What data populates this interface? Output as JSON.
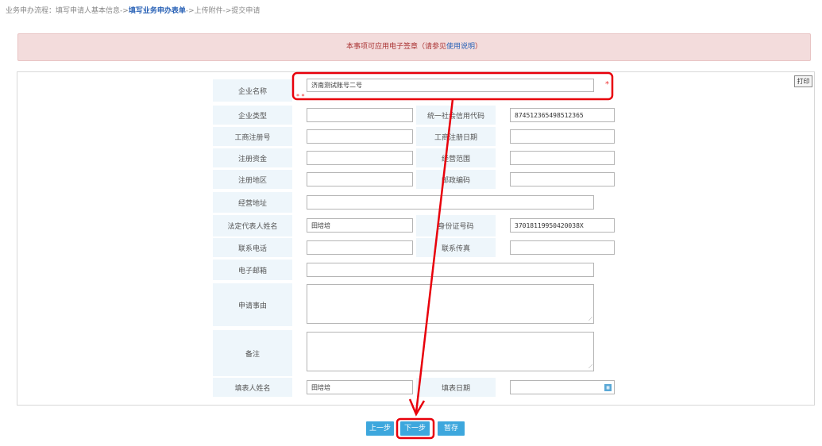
{
  "breadcrumb": {
    "prefix": "业务申办流程：",
    "step1": "填写申请人基本信息->",
    "current": "填写业务申办表单",
    "step3": "->上传附件->",
    "step4": "提交申请"
  },
  "notice": {
    "text": "本事项可应用电子签章（请参见",
    "link": "使用说明",
    "suffix": "）"
  },
  "print_label": "打印",
  "form": {
    "company_name": {
      "label": "企业名称",
      "value": "济南测试账号二号"
    },
    "company_type": {
      "label": "企业类型",
      "value": ""
    },
    "credit_code": {
      "label": "统一社会信用代码",
      "value": "874512365498512365"
    },
    "reg_no": {
      "label": "工商注册号",
      "value": ""
    },
    "reg_date": {
      "label": "工商注册日期",
      "value": ""
    },
    "capital": {
      "label": "注册资金",
      "value": ""
    },
    "scope": {
      "label": "经营范围",
      "value": ""
    },
    "region": {
      "label": "注册地区",
      "value": ""
    },
    "postcode": {
      "label": "邮政编码",
      "value": ""
    },
    "address": {
      "label": "经营地址",
      "value": ""
    },
    "legal_rep": {
      "label": "法定代表人姓名",
      "value": "田培培"
    },
    "id_no": {
      "label": "身份证号码",
      "value": "37018119950420038X"
    },
    "phone": {
      "label": "联系电话",
      "value": ""
    },
    "fax": {
      "label": "联系传真",
      "value": ""
    },
    "email": {
      "label": "电子邮箱",
      "value": ""
    },
    "reason": {
      "label": "申请事由",
      "value": ""
    },
    "remark": {
      "label": "备注",
      "value": ""
    },
    "filler": {
      "label": "填表人姓名",
      "value": "田培培"
    },
    "fill_date": {
      "label": "填表日期",
      "value": ""
    }
  },
  "buttons": {
    "prev": "上一步",
    "next": "下一步",
    "save": "暂存"
  },
  "colors": {
    "annotation": "#e8000b",
    "button": "#3da7dd",
    "label_bg": "#eef6fb",
    "notice_bg": "#f3dcdc"
  }
}
